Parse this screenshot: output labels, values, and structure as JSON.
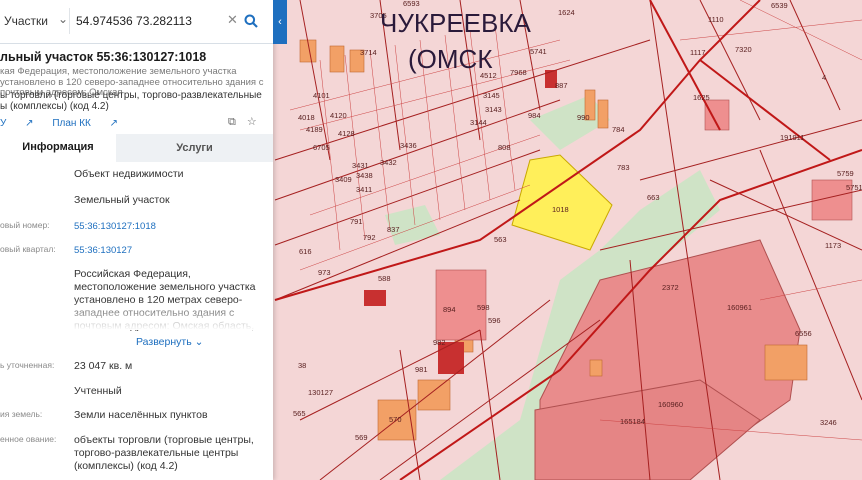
{
  "search": {
    "mode": "Участки",
    "query": "54.974536 73.282113"
  },
  "panel": {
    "title": "льный участок 55:36:130127:1018",
    "description": "кая Федерация, местоположение земельного участка установлено в 120 северо-западнее относительно здания с почтовым адресом: Омская",
    "kind": "ы торговли (торговые центры, торгово-развлекательные ы (комплексы) (код 4.2)",
    "link_left": "У",
    "link_plan": "План КК",
    "tabs": [
      "Информация",
      "Услуги"
    ],
    "rows": [
      {
        "label": "",
        "value": "Объект недвижимости"
      },
      {
        "label": "",
        "value": "Земельный участок"
      },
      {
        "label": "овый номер:",
        "value": "55:36:130127:1018"
      },
      {
        "label": "овый квартал:",
        "value": "55:36:130127"
      },
      {
        "label": "",
        "value": "Российская Федерация, местоположение земельного участка установлено в 120 метрах северо-западнее относительно здания с почтовым адресом: Омская область,"
      },
      {
        "label": "ь уточненная:",
        "value": "23 047 кв. м"
      },
      {
        "label": "",
        "value": "Учтенный"
      },
      {
        "label": "ия земель:",
        "value": "Земли населённых пунктов"
      },
      {
        "label": "енное ование:",
        "value": "объекты торговли (торговые центры, торгово-развлекательные центры (комплексы) (код 4.2)"
      }
    ],
    "expand": "Развернуть"
  },
  "map": {
    "place_name_1": "ЧУКРЕЕВКА",
    "place_name_2": "(ОМСК",
    "parcel_ids": [
      "6593",
      "3705",
      "1624",
      "1110",
      "6539",
      "3714",
      "5741",
      "4512",
      "1117",
      "7320",
      "7968",
      "4101",
      "4018",
      "4189",
      "4120",
      "4128",
      "3145",
      "3436",
      "3143",
      "3144",
      "887",
      "6705",
      "3431",
      "3409",
      "3438",
      "3432",
      "3411",
      "984",
      "990",
      "808",
      "784",
      "1018",
      "783",
      "663",
      "563",
      "837",
      "791",
      "792",
      "588",
      "981",
      "894",
      "982",
      "598",
      "596",
      "616",
      "973",
      "38",
      "130127",
      "565",
      "569",
      "570",
      "2372",
      "160961",
      "160960",
      "165184",
      "1173",
      "6556",
      "1625",
      "3246",
      "191911",
      "4",
      "5759",
      "5751"
    ],
    "highlight_color": "#ffef5a",
    "map_bg": "#f4d6d6"
  }
}
